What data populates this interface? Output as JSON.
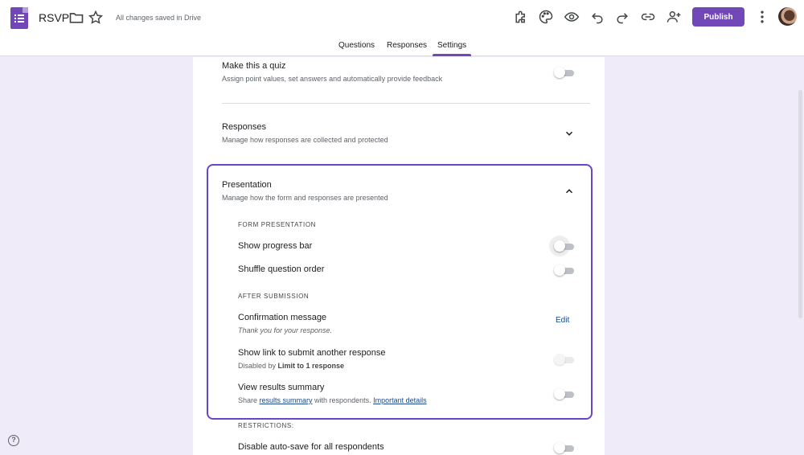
{
  "header": {
    "title": "RSVP",
    "saved_status": "All changes saved in Drive",
    "publish_label": "Publish"
  },
  "tabs": [
    {
      "label": "Questions"
    },
    {
      "label": "Responses"
    },
    {
      "label": "Settings",
      "active": true
    }
  ],
  "settings": {
    "quiz": {
      "title": "Make this a quiz",
      "description": "Assign point values, set answers and automatically provide feedback",
      "enabled": false
    },
    "responses": {
      "title": "Responses",
      "description": "Manage how responses are collected and protected"
    },
    "presentation": {
      "title": "Presentation",
      "description": "Manage how the form and responses are presented",
      "form_presentation_label": "FORM PRESENTATION",
      "show_progress_bar": {
        "label": "Show progress bar",
        "enabled": false
      },
      "shuffle_question_order": {
        "label": "Shuffle question order",
        "enabled": false
      },
      "after_submission_label": "AFTER SUBMISSION",
      "confirmation_message": {
        "label": "Confirmation message",
        "value": "Thank you for your response.",
        "edit_label": "Edit"
      },
      "show_link_another": {
        "label": "Show link to submit another response",
        "disabled_prefix": "Disabled by ",
        "disabled_reason": "Limit to 1 response",
        "enabled": false
      },
      "view_results_summary": {
        "label": "View results summary",
        "desc_prefix": "Share ",
        "desc_link1": "results summary",
        "desc_middle": " with respondents. ",
        "desc_link2": "Important details",
        "enabled": false
      }
    },
    "restrictions": {
      "label": "RESTRICTIONS:",
      "disable_autosave": {
        "label": "Disable auto-save for all respondents",
        "enabled": false
      }
    }
  },
  "help_label": "?",
  "colors": {
    "accent": "#7248b9",
    "focus_border": "#6b44c7",
    "link": "#1a4a8c",
    "background": "#f0ebf8"
  }
}
